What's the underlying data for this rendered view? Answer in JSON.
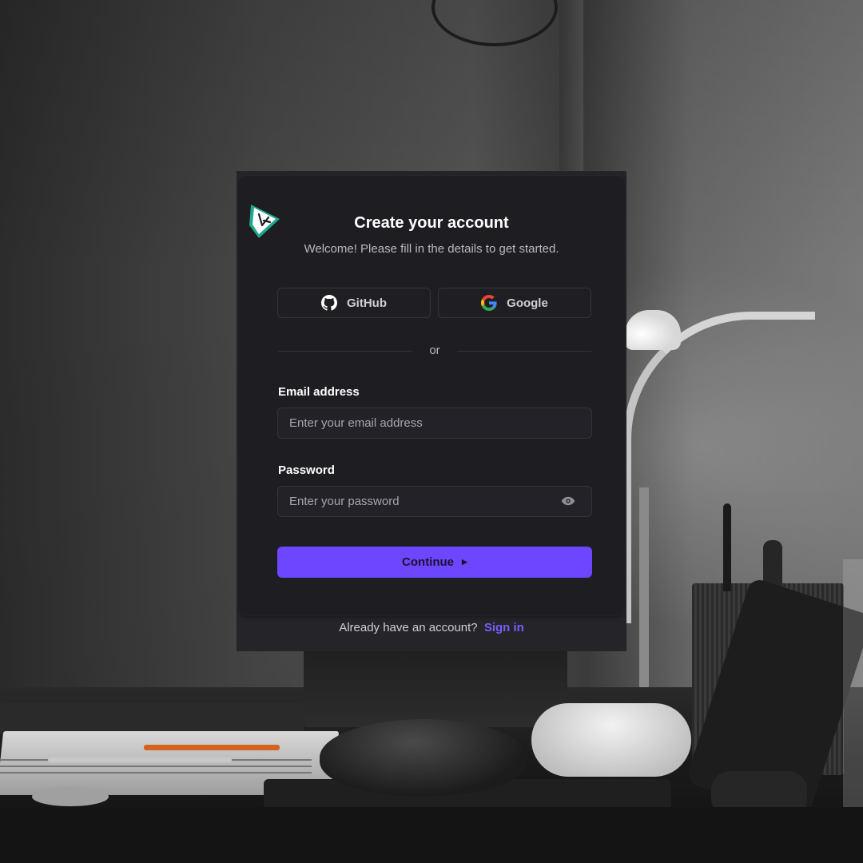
{
  "card": {
    "title": "Create your account",
    "subtitle": "Welcome! Please fill in the details to get started.",
    "social": {
      "github_label": "GitHub",
      "google_label": "Google"
    },
    "divider_text": "or",
    "email": {
      "label": "Email address",
      "placeholder": "Enter your email address",
      "value": ""
    },
    "password": {
      "label": "Password",
      "placeholder": "Enter your password",
      "value": ""
    },
    "continue_label": "Continue",
    "footer": {
      "prompt": "Already have an account?",
      "link": "Sign in"
    }
  },
  "colors": {
    "accent": "#6d47ff",
    "link": "#7c5cff",
    "card_bg": "#1d1d22",
    "logo_teal": "#1fa88a"
  },
  "icons": [
    "logo-icon",
    "github-icon",
    "google-icon",
    "eye-icon",
    "play-arrow-icon"
  ]
}
